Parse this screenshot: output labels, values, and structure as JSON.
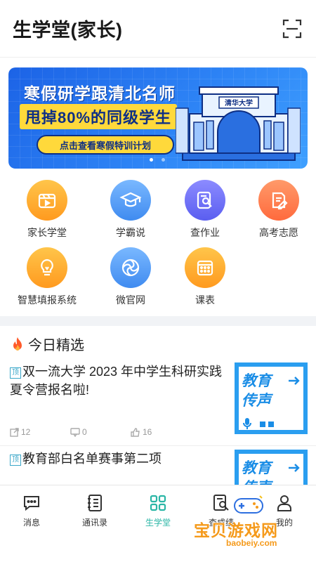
{
  "header": {
    "title": "生学堂(家长)"
  },
  "banner": {
    "line1": "寒假研学跟清北名师",
    "line2": "甩掉80%的同级学生",
    "cta": "点击查看寒假特训计划",
    "gate_sign": "清华大学"
  },
  "grid": [
    {
      "label": "家长学堂",
      "icon": "video-clapper-icon",
      "color": "#ffb238"
    },
    {
      "label": "学霸说",
      "icon": "graduation-cap-icon",
      "color": "#5a9cf5"
    },
    {
      "label": "查作业",
      "icon": "search-book-icon",
      "color": "#6b6cf5"
    },
    {
      "label": "高考志愿",
      "icon": "pen-paper-icon",
      "color": "#ff7a48"
    },
    {
      "label": "智慧填报系统",
      "icon": "bulb-icon",
      "color": "#ffaa3c"
    },
    {
      "label": "微官网",
      "icon": "aperture-icon",
      "color": "#4d93f2"
    },
    {
      "label": "课表",
      "icon": "calendar-grid-icon",
      "color": "#ffab2f"
    }
  ],
  "section": {
    "title": "今日精选"
  },
  "articles": [
    {
      "tag": "顶",
      "title": "双一流大学 2023 年中学生科研实践夏令营报名啦!",
      "shares": "12",
      "comments": "0",
      "likes": "16",
      "thumb_line1": "教育",
      "thumb_line2": "传声"
    },
    {
      "tag": "顶",
      "title": "教育部白名单赛事第二项",
      "thumb_line1": "教育",
      "thumb_line2": "传声"
    }
  ],
  "bottom_nav": [
    {
      "label": "消息",
      "icon": "chat-icon"
    },
    {
      "label": "通讯录",
      "icon": "contacts-book-icon"
    },
    {
      "label": "生学堂",
      "icon": "grid-apps-icon",
      "active": true
    },
    {
      "label": "查成绩",
      "icon": "score-search-icon"
    },
    {
      "label": "我的",
      "icon": "person-icon"
    }
  ],
  "watermark": {
    "text": "宝贝游戏网",
    "url": "baobeiy.com"
  }
}
